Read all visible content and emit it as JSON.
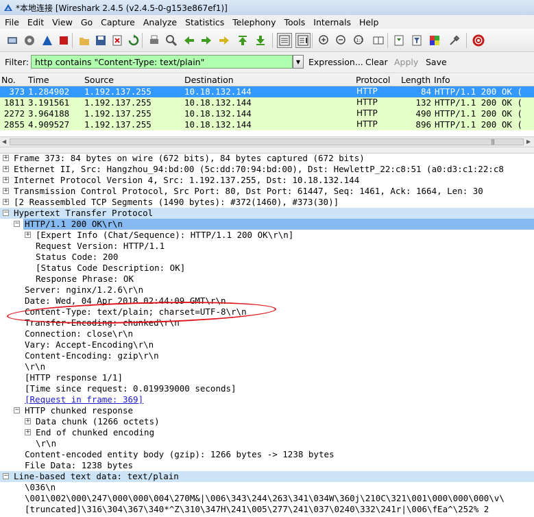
{
  "window": {
    "title": "*本地连接 [Wireshark 2.4.5 (v2.4.5-0-g153e867ef1)]"
  },
  "menu": [
    "File",
    "Edit",
    "View",
    "Go",
    "Capture",
    "Analyze",
    "Statistics",
    "Telephony",
    "Tools",
    "Internals",
    "Help"
  ],
  "toolbar": {
    "icons": [
      "interface-list-icon",
      "capture-options-icon",
      "start-capture-icon",
      "stop-capture-icon",
      "open-file-icon",
      "save-file-icon",
      "close-file-icon",
      "reload-icon",
      "print-icon",
      "find-packet-icon",
      "go-back-icon",
      "go-forward-icon",
      "go-to-packet-icon",
      "go-first-icon",
      "go-last-icon",
      "colorize-icon",
      "auto-scroll-icon",
      "zoom-in-icon",
      "zoom-out-icon",
      "zoom-normal-icon",
      "resize-columns-icon",
      "capture-filters-icon",
      "display-filters-icon",
      "coloring-rules-icon",
      "preferences-icon",
      "help-icon"
    ]
  },
  "filter": {
    "label": "Filter:",
    "value": "http contains \"Content-Type: text/plain\"",
    "expression": "Expression...",
    "clear": "Clear",
    "apply": "Apply",
    "save": "Save"
  },
  "columns": {
    "no": "No.",
    "time": "Time",
    "source": "Source",
    "destination": "Destination",
    "protocol": "Protocol",
    "length": "Length",
    "info": "Info"
  },
  "packets": [
    {
      "no": "373",
      "time": "1.284902",
      "source": "1.192.137.255",
      "destination": "10.18.132.144",
      "protocol": "HTTP",
      "length": "84",
      "info": "HTTP/1.1 200 OK  (",
      "selected": true
    },
    {
      "no": "1811",
      "time": "3.191561",
      "source": "1.192.137.255",
      "destination": "10.18.132.144",
      "protocol": "HTTP",
      "length": "132",
      "info": "HTTP/1.1 200 OK  (",
      "selected": false
    },
    {
      "no": "2272",
      "time": "3.964188",
      "source": "1.192.137.255",
      "destination": "10.18.132.144",
      "protocol": "HTTP",
      "length": "490",
      "info": "HTTP/1.1 200 OK  (",
      "selected": false
    },
    {
      "no": "2855",
      "time": "4.909527",
      "source": "1.192.137.255",
      "destination": "10.18.132.144",
      "protocol": "HTTP",
      "length": "896",
      "info": "HTTP/1.1 200 OK  (",
      "selected": false
    }
  ],
  "colors": {
    "selected_row": "#3399ff",
    "http_row": "#e4ffc7",
    "filter_ok": "#afffaf",
    "annotation": "#e0141c"
  },
  "details": [
    {
      "level": 0,
      "exp": "+",
      "text": "Frame 373: 84 bytes on wire (672 bits), 84 bytes captured (672 bits)"
    },
    {
      "level": 0,
      "exp": "+",
      "text": "Ethernet II, Src: Hangzhou_94:bd:00 (5c:dd:70:94:bd:00), Dst: HewlettP_22:c8:51 (a0:d3:c1:22:c8"
    },
    {
      "level": 0,
      "exp": "+",
      "text": "Internet Protocol Version 4, Src: 1.192.137.255, Dst: 10.18.132.144"
    },
    {
      "level": 0,
      "exp": "+",
      "text": "Transmission Control Protocol, Src Port: 80, Dst Port: 61447, Seq: 1461, Ack: 1664, Len: 30"
    },
    {
      "level": 0,
      "exp": "+",
      "text": "[2 Reassembled TCP Segments (1490 bytes): #372(1460), #373(30)]"
    },
    {
      "level": 0,
      "exp": "-",
      "text": "Hypertext Transfer Protocol",
      "hl": "light"
    },
    {
      "level": 1,
      "exp": "-",
      "text": "HTTP/1.1 200 OK\\r\\n",
      "hl": "dark"
    },
    {
      "level": 2,
      "exp": "+",
      "text": "[Expert Info (Chat/Sequence): HTTP/1.1 200 OK\\r\\n]"
    },
    {
      "level": 3,
      "text": "Request Version: HTTP/1.1"
    },
    {
      "level": 3,
      "text": "Status Code: 200"
    },
    {
      "level": 3,
      "text": "[Status Code Description: OK]"
    },
    {
      "level": 3,
      "text": "Response Phrase: OK"
    },
    {
      "level": 1,
      "text": "Server: nginx/1.2.6\\r\\n"
    },
    {
      "level": 1,
      "text": "Date: Wed, 04 Apr 2018 02:44:09 GMT\\r\\n"
    },
    {
      "level": 1,
      "text": "Content-Type: text/plain; charset=UTF-8\\r\\n"
    },
    {
      "level": 1,
      "text": "Transfer-Encoding: chunked\\r\\n"
    },
    {
      "level": 1,
      "text": "Connection: close\\r\\n"
    },
    {
      "level": 1,
      "text": "Vary: Accept-Encoding\\r\\n"
    },
    {
      "level": 1,
      "text": "Content-Encoding: gzip\\r\\n"
    },
    {
      "level": 1,
      "text": "\\r\\n"
    },
    {
      "level": 1,
      "text": "[HTTP response 1/1]"
    },
    {
      "level": 1,
      "text": "[Time since request: 0.019939000 seconds]"
    },
    {
      "level": 1,
      "text": "[Request in frame: 369]",
      "link": true
    },
    {
      "level": 1,
      "exp": "-",
      "text": "HTTP chunked response"
    },
    {
      "level": 2,
      "exp": "+",
      "text": "Data chunk (1266 octets)"
    },
    {
      "level": 2,
      "exp": "+",
      "text": "End of chunked encoding"
    },
    {
      "level": 3,
      "text": "\\r\\n"
    },
    {
      "level": 1,
      "text": "Content-encoded entity body (gzip): 1266 bytes -> 1238 bytes"
    },
    {
      "level": 1,
      "text": "File Data: 1238 bytes"
    },
    {
      "level": 0,
      "exp": "-",
      "text": "Line-based text data: text/plain",
      "hl": "light"
    },
    {
      "level": 1,
      "text": "\\036\\n"
    },
    {
      "level": 1,
      "text": "\\001\\002\\000\\247\\000\\000\\004\\270M&|\\006\\343\\244\\263\\341\\034W\\360j\\210C\\321\\001\\000\\000\\000\\v\\"
    },
    {
      "level": 1,
      "text": "[truncated]\\316\\304\\367\\340*^Z\\310\\347H\\241\\005\\277\\241\\037\\0240\\332\\241r|\\006\\fEa^\\252% 2"
    }
  ]
}
